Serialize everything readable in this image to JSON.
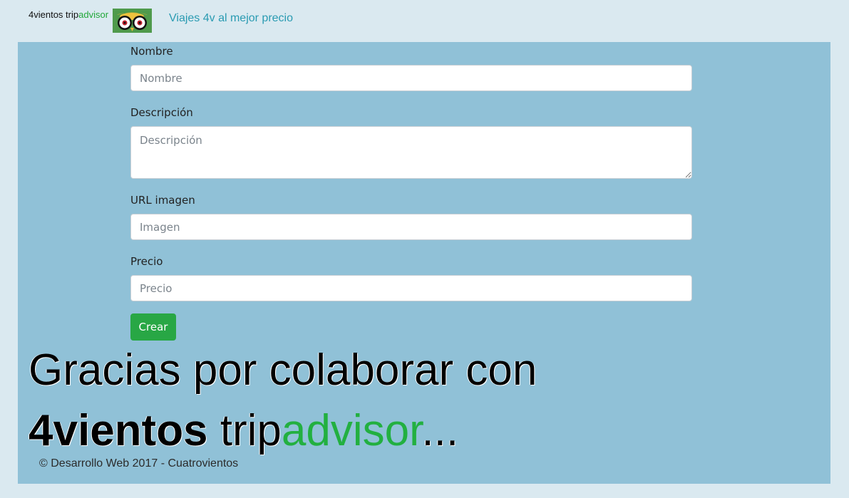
{
  "header": {
    "brand_a": "4vientos",
    "brand_trip": "trip",
    "brand_advisor": "advisor",
    "logo_icon": "owl-eyes-icon",
    "tagline": "Viajes 4v al mejor precio"
  },
  "form": {
    "nombre_label": "Nombre",
    "nombre_placeholder": "Nombre",
    "descripcion_label": "Descripción",
    "descripcion_placeholder": "Descripción",
    "imagen_label": "URL imagen",
    "imagen_placeholder": "Imagen",
    "precio_label": "Precio",
    "precio_placeholder": "Precio",
    "submit_label": "Crear"
  },
  "thanks": {
    "line1": "Gracias por colaborar con",
    "brand_a": "4vientos",
    "brand_trip": "trip",
    "brand_advisor": "advisor",
    "ellipsis": "..."
  },
  "footer": {
    "text": "© Desarrollo Web 2017 - Cuatrovientos"
  },
  "colors": {
    "page_bg": "#dae9f0",
    "panel_bg": "#90c1d7",
    "accent_green": "#22b040",
    "button_green": "#28a745",
    "tagline": "#2a9bb2"
  }
}
